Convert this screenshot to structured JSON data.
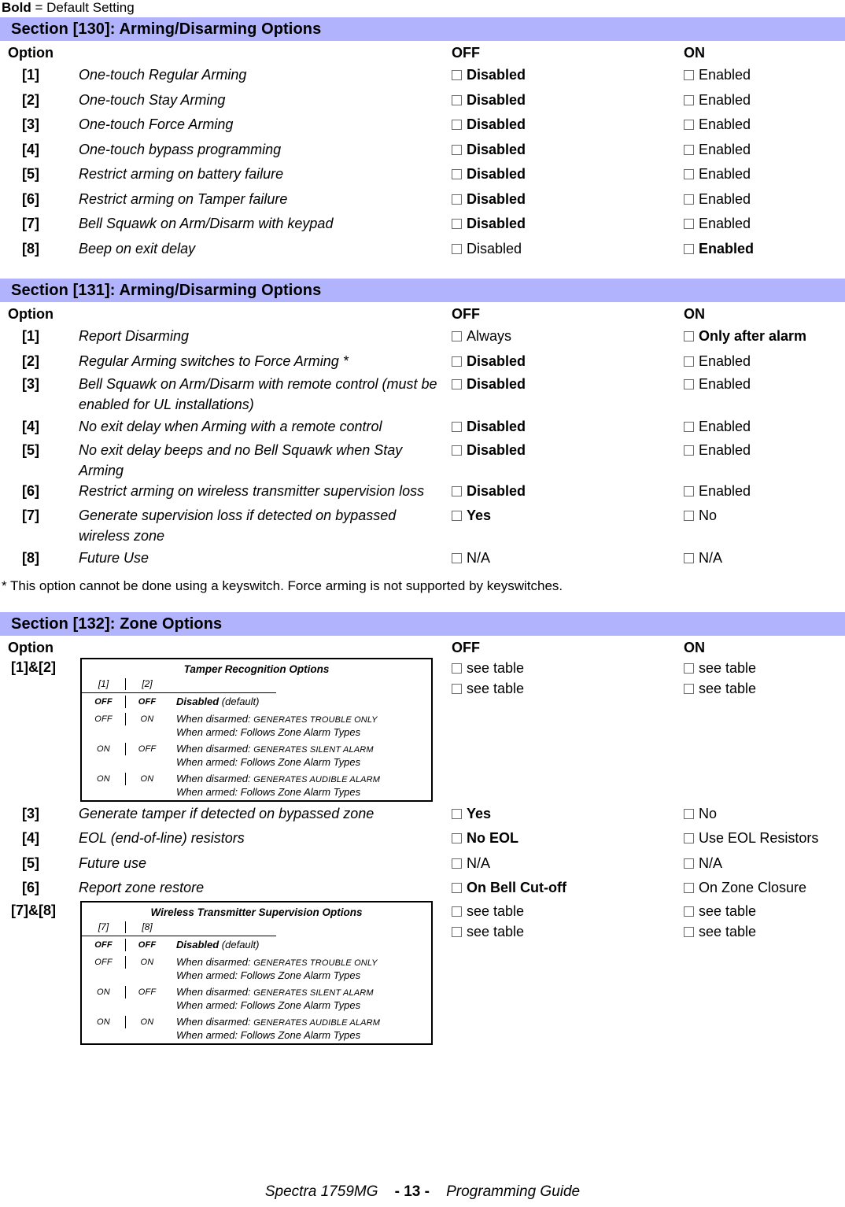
{
  "legend": {
    "bold_word": "Bold",
    "rest": " = Default Setting"
  },
  "sections": [
    {
      "bar_title": "Section [130]: Arming/Disarming Options",
      "header": {
        "option": "Option",
        "off": "OFF",
        "on": "ON"
      },
      "rows": [
        {
          "num": "[1]",
          "desc": "One-touch Regular Arming",
          "off": "Disabled",
          "off_bold": true,
          "on": "Enabled",
          "on_bold": false
        },
        {
          "num": "[2]",
          "desc": "One-touch Stay Arming",
          "off": "Disabled",
          "off_bold": true,
          "on": "Enabled",
          "on_bold": false
        },
        {
          "num": "[3]",
          "desc": "One-touch Force Arming",
          "off": "Disabled",
          "off_bold": true,
          "on": "Enabled",
          "on_bold": false
        },
        {
          "num": "[4]",
          "desc": "One-touch bypass programming",
          "off": "Disabled",
          "off_bold": true,
          "on": "Enabled",
          "on_bold": false
        },
        {
          "num": "[5]",
          "desc": "Restrict arming on battery failure",
          "off": "Disabled",
          "off_bold": true,
          "on": "Enabled",
          "on_bold": false
        },
        {
          "num": "[6]",
          "desc": "Restrict arming on Tamper failure",
          "off": "Disabled",
          "off_bold": true,
          "on": "Enabled",
          "on_bold": false
        },
        {
          "num": "[7]",
          "desc": "Bell Squawk on Arm/Disarm with keypad",
          "off": "Disabled",
          "off_bold": true,
          "on": "Enabled",
          "on_bold": false
        },
        {
          "num": "[8]",
          "desc": "Beep on exit delay",
          "off": "Disabled",
          "off_bold": false,
          "on": "Enabled",
          "on_bold": true
        }
      ]
    },
    {
      "bar_title": "Section [131]: Arming/Disarming Options",
      "header": {
        "option": "Option",
        "off": "OFF",
        "on": "ON"
      },
      "rows": [
        {
          "num": "[1]",
          "desc": "Report Disarming",
          "off": "Always",
          "off_bold": false,
          "on": "Only after alarm",
          "on_bold": true
        },
        {
          "num": "[2]",
          "desc": "Regular Arming switches to Force Arming *",
          "off": "Disabled",
          "off_bold": true,
          "on": "Enabled",
          "on_bold": false
        },
        {
          "num": "[3]",
          "desc": "Bell Squawk on Arm/Disarm with remote control (must be enabled for UL installations)",
          "off": "Disabled",
          "off_bold": true,
          "on": "Enabled",
          "on_bold": false,
          "two_line": true
        },
        {
          "num": "[4]",
          "desc": "No exit delay when Arming with a remote control",
          "off": "Disabled",
          "off_bold": true,
          "on": "Enabled",
          "on_bold": false
        },
        {
          "num": "[5]",
          "desc": "No exit delay beeps and no Bell Squawk when Stay Arming",
          "off": "Disabled",
          "off_bold": true,
          "on": "Enabled",
          "on_bold": false,
          "two_line": true
        },
        {
          "num": "[6]",
          "desc": "Restrict arming on wireless transmitter supervision loss",
          "off": "Disabled",
          "off_bold": true,
          "on": "Enabled",
          "on_bold": false,
          "two_line": true
        },
        {
          "num": "[7]",
          "desc": "Generate supervision loss if detected on bypassed wireless zone",
          "off": "Yes",
          "off_bold": true,
          "on": "No",
          "on_bold": false,
          "two_line": true
        },
        {
          "num": "[8]",
          "desc": "Future Use",
          "off": "N/A",
          "off_bold": false,
          "on": "N/A",
          "on_bold": false
        }
      ]
    }
  ],
  "footnote": "* This option cannot be done using a keyswitch. Force arming is not supported by keyswitches.",
  "section132": {
    "bar_title": "Section [132]: Zone Options",
    "header": {
      "option": "Option",
      "off": "OFF",
      "on": "ON"
    },
    "row_1_2": {
      "num": "[1]&[2]",
      "off_line1": "see table",
      "off_line2": "see table",
      "on_line1": "see table",
      "on_line2": "see table",
      "table": {
        "title": "Tamper Recognition Options",
        "col1": "[1]",
        "col2": "[2]",
        "rows": [
          {
            "c1": "OFF",
            "c2": "OFF",
            "c1_bold": true,
            "c2_bold": true,
            "desc_bold": "Disabled",
            "desc_rest": " (default)",
            "line2": ""
          },
          {
            "c1": "OFF",
            "c2": "ON",
            "c1_bold": false,
            "c2_bold": false,
            "line1_pre": "When disarmed: ",
            "line1_sc": "GENERATES TROUBLE ONLY",
            "line2_pre": "When armed: Follows ",
            "line2_it": "Zone Alarm Types"
          },
          {
            "c1": "ON",
            "c2": "OFF",
            "c1_bold": false,
            "c2_bold": false,
            "line1_pre": "When disarmed: ",
            "line1_sc": "GENERATES SILENT ALARM",
            "line2_pre": "When armed: Follows ",
            "line2_it": "Zone Alarm Types"
          },
          {
            "c1": "ON",
            "c2": "ON",
            "c1_bold": false,
            "c2_bold": false,
            "line1_pre": "When disarmed: ",
            "line1_sc": "GENERATES AUDIBLE ALARM",
            "line2_pre": "When armed: Follows ",
            "line2_it": "Zone Alarm Types"
          }
        ]
      }
    },
    "rows": [
      {
        "num": "[3]",
        "desc": "Generate tamper if detected on bypassed zone",
        "off": "Yes",
        "off_bold": true,
        "on": "No",
        "on_bold": false
      },
      {
        "num": "[4]",
        "desc": "EOL (end-of-line) resistors",
        "off": "No EOL",
        "off_bold": true,
        "on": "Use EOL Resistors",
        "on_bold": false
      },
      {
        "num": "[5]",
        "desc": "Future use",
        "off": "N/A",
        "off_bold": false,
        "on": "N/A",
        "on_bold": false
      },
      {
        "num": "[6]",
        "desc": "Report zone restore",
        "off": "On Bell Cut-off",
        "off_bold": true,
        "on": "On Zone Closure",
        "on_bold": false
      }
    ],
    "row_7_8": {
      "num": "[7]&[8]",
      "off_line1": "see table",
      "off_line2": "see table",
      "on_line1": "see table",
      "on_line2": "see table",
      "table": {
        "title": "Wireless Transmitter Supervision Options",
        "col1": "[7]",
        "col2": "[8]",
        "rows": [
          {
            "c1": "OFF",
            "c2": "OFF",
            "c1_bold": true,
            "c2_bold": true,
            "desc_bold": "Disabled",
            "desc_rest": " (default)",
            "line2": ""
          },
          {
            "c1": "OFF",
            "c2": "ON",
            "c1_bold": false,
            "c2_bold": false,
            "line1_pre": "When disarmed: ",
            "line1_sc": "GENERATES TROUBLE ONLY",
            "line2_pre": "When armed: Follows ",
            "line2_it": "Zone Alarm Types"
          },
          {
            "c1": "ON",
            "c2": "OFF",
            "c1_bold": false,
            "c2_bold": false,
            "line1_pre": "When disarmed: ",
            "line1_sc": "GENERATES SILENT ALARM",
            "line2_pre": "When armed: Follows ",
            "line2_it": "Zone Alarm Types"
          },
          {
            "c1": "ON",
            "c2": "ON",
            "c1_bold": false,
            "c2_bold": false,
            "line1_pre": "When disarmed: ",
            "line1_sc": "GENERATES AUDIBLE ALARM",
            "line2_pre": "When armed: Follows ",
            "line2_it": "Zone Alarm Types"
          }
        ]
      }
    }
  },
  "footer": {
    "product": "Spectra 1759MG",
    "page": "- 13 -",
    "guide": "Programming Guide"
  },
  "colors": {
    "section_bar": "#b1b4fd",
    "text": "#000000",
    "checkbox_border": "#6a6a6a"
  }
}
